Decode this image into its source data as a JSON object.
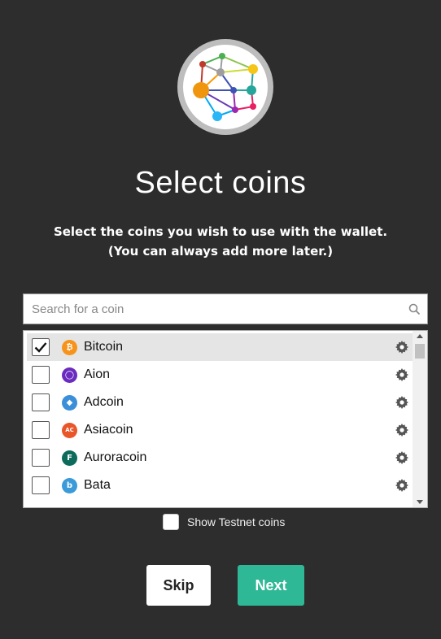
{
  "title": "Select coins",
  "subtitle_line1": "Select the coins you wish to use with the wallet.",
  "subtitle_line2": "(You can always add more later.)",
  "search": {
    "placeholder": "Search for a coin",
    "value": ""
  },
  "coins": [
    {
      "name": "Bitcoin",
      "checked": true,
      "icon": "bitcoin-icon",
      "color": "#f7931a",
      "glyph": "₿"
    },
    {
      "name": "Aion",
      "checked": false,
      "icon": "aion-icon",
      "color": "#6a2bbf",
      "glyph": "◯"
    },
    {
      "name": "Adcoin",
      "checked": false,
      "icon": "adcoin-icon",
      "color": "#3b8fd9",
      "glyph": "◆"
    },
    {
      "name": "Asiacoin",
      "checked": false,
      "icon": "asiacoin-icon",
      "color": "#e8562a",
      "glyph": "AC"
    },
    {
      "name": "Auroracoin",
      "checked": false,
      "icon": "auroracoin-icon",
      "color": "#0d6b5c",
      "glyph": "F"
    },
    {
      "name": "Bata",
      "checked": false,
      "icon": "bata-icon",
      "color": "#3a9bd8",
      "glyph": "b"
    }
  ],
  "testnet": {
    "label": "Show Testnet coins",
    "checked": false
  },
  "buttons": {
    "skip": "Skip",
    "next": "Next"
  },
  "colors": {
    "background": "#2d2d2d",
    "accent": "#2fb896"
  }
}
